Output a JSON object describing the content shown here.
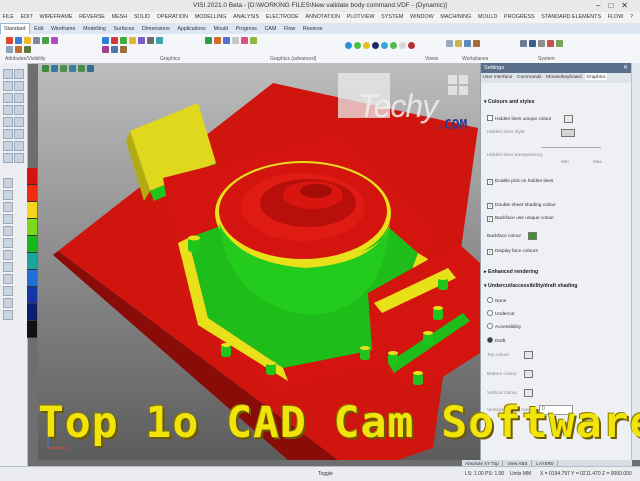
{
  "window": {
    "title": "VISI 2021.0 Beta - [D:\\WORKING FILES\\New validate body command.VDF - (Dynamic)]"
  },
  "menu": [
    "FILE",
    "EDIT",
    "WIREFRAME",
    "REVERSE",
    "MESH",
    "SOLID",
    "OPERATION",
    "MODELLING",
    "ANALYSIS",
    "ELECTRODE",
    "ANNOTATION",
    "PLOTVIEW",
    "SYSTEM",
    "WINDOW",
    "MACHINING",
    "MOULD",
    "PROGRESS",
    "STANDARD ELEMENTS",
    "FLOW",
    "?"
  ],
  "ribbon_tabs": [
    "Standard",
    "Edit",
    "Wireframe",
    "Modelling",
    "Surfaces",
    "Dimensions",
    "Applications",
    "Mould",
    "Progress",
    "CAM",
    "Flow",
    "Reverse"
  ],
  "ribbon_groups": [
    "Attributes/Visibility",
    "Graphics",
    "Graphics (advanced)",
    "Views",
    "Workplanes",
    "System"
  ],
  "settings": {
    "title": "Settings",
    "close": "✕",
    "tabs": [
      "User interface",
      "Commands",
      "Mouse/keyboard",
      "Graphics"
    ],
    "sections": {
      "colours": "Colours and styles",
      "enhanced": "Enhanced rendering",
      "undercut": "Undercut/accessibility/draft shading"
    },
    "options": {
      "hidden_lines_unique": "Hidden lines unique colour",
      "hidden_lines_style": "Hidden lines style",
      "hidden_lines_transparency": "Hidden lines transparency",
      "min": "Min",
      "max": "Max",
      "pick_hidden": "Enable pick on hidden lines",
      "double_sheet": "Double sheet shading colour",
      "backface_unique": "Backface use unique colour",
      "backface_colour": "Backface colour",
      "display_face": "Display face colours",
      "none": "None",
      "undercut": "Undercut",
      "accessibility": "Accessibility",
      "draft": "Draft",
      "top_colour": "Top colour",
      "bottom_colour": "Bottom colour",
      "vertical_colour": "Vertical colour",
      "vertical_angle": "Vertical angular range",
      "vertical_angle_value": "0"
    }
  },
  "status": {
    "toggle": "Toggle",
    "scale": "LS: 1.00 PS: 1.00",
    "view_tabs": [
      "Absolute XY Top",
      "View ABS",
      "LAYER0"
    ],
    "units": "Units MM",
    "coords": "X = 0194.797 Y = 0211.470 Z = 0000.000"
  },
  "watermark": {
    "text": "Techy",
    "domain": ".COM"
  },
  "caption": "Top 1o CAD Cam Software",
  "colors": {
    "red": "#d80f0f",
    "green": "#1fc51a",
    "yellow": "#e8e11a",
    "caption": "#f1e40a"
  },
  "color_scale": [
    "#d41313",
    "#f12a12",
    "#f5d41c",
    "#7bd91a",
    "#19b81a",
    "#1da59d",
    "#1f6fd8",
    "#1636a6",
    "#0b1f70",
    "#111111"
  ]
}
